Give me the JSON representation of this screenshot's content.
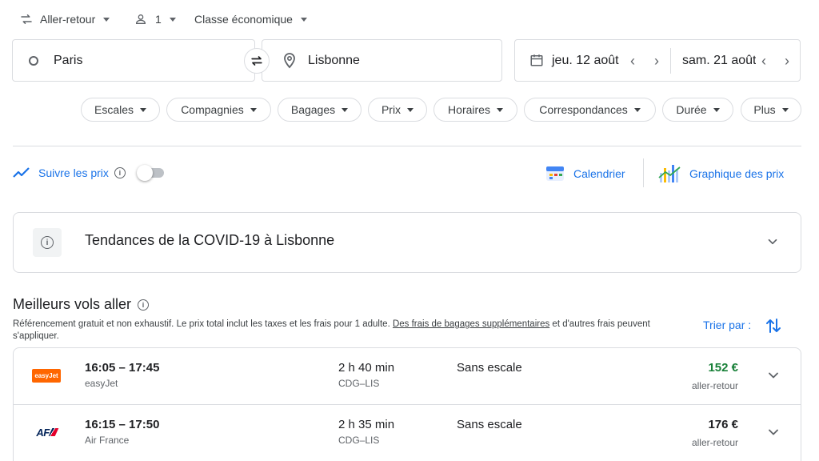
{
  "trip_options": {
    "trip_type": "Aller-retour",
    "passengers": "1",
    "cabin_class": "Classe économique"
  },
  "search": {
    "origin": "Paris",
    "destination": "Lisbonne",
    "depart_date": "jeu. 12 août",
    "return_date": "sam. 21 août"
  },
  "filters": [
    "Escales",
    "Compagnies",
    "Bagages",
    "Prix",
    "Horaires",
    "Correspondances",
    "Durée",
    "Plus"
  ],
  "tools": {
    "track_prices": "Suivre les prix",
    "calendar": "Calendrier",
    "price_graph": "Graphique des prix"
  },
  "covid_card": {
    "title": "Tendances de la COVID-19 à Lisbonne"
  },
  "best_flights": {
    "heading": "Meilleurs vols aller",
    "note_before": "Référencement gratuit et non exhaustif. Le prix total inclut les taxes et les frais pour 1 adulte. ",
    "note_link": "Des frais de bagages supplémentaires",
    "note_after": " et d'autres frais peuvent s'appliquer.",
    "sort_label": "Trier par :"
  },
  "flights": [
    {
      "times": "16:05 – 17:45",
      "airline": "easyJet",
      "logo_text": "easyJet",
      "logo_color": "#ff6600",
      "duration": "2 h 40 min",
      "route": "CDG–LIS",
      "stops": "Sans escale",
      "price": "152 €",
      "price_color": "#188038",
      "price_type": "aller-retour"
    },
    {
      "times": "16:15 – 17:50",
      "airline": "Air France",
      "logo_text": "AF",
      "logo_color": "#002157",
      "duration": "2 h 35 min",
      "route": "CDG–LIS",
      "stops": "Sans escale",
      "price": "176 €",
      "price_color": "#202124",
      "price_type": "aller-retour"
    }
  ],
  "colors": {
    "accent": "#1a73e8",
    "border": "#dadce0",
    "good_price": "#188038"
  }
}
